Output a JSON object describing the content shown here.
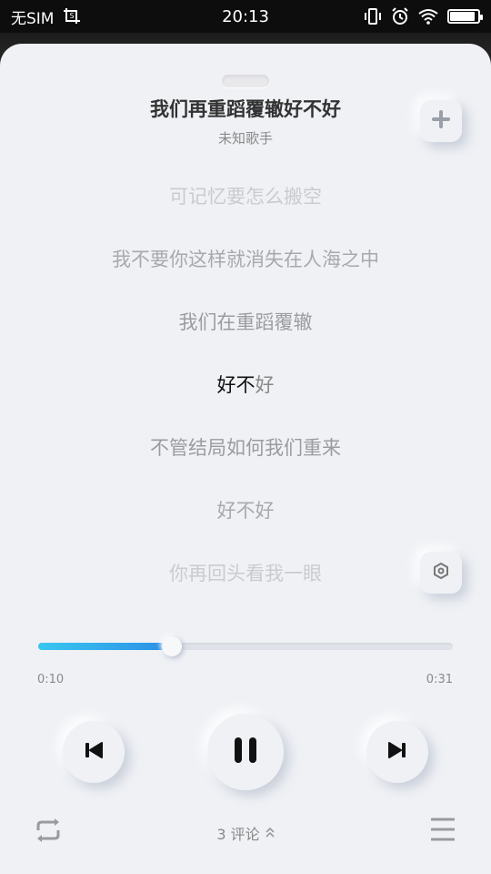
{
  "status_bar": {
    "carrier": "无SIM",
    "time": "20:13",
    "battery_level": 0.9
  },
  "song": {
    "title": "我们再重蹈覆辙好不好",
    "artist": "未知歌手"
  },
  "lyrics": {
    "lines": [
      "可记忆要怎么搬空",
      "我不要你这样就消失在人海之中",
      "我们在重蹈覆辙",
      "好不好",
      "不管结局如何我们重来",
      "好不好",
      "你再回头看我一眼"
    ],
    "current_index": 3,
    "current_sung": "好不",
    "current_rest": "好"
  },
  "progress": {
    "current": "0:10",
    "total": "0:31",
    "fraction": 0.322
  },
  "footer": {
    "comments_label": "3 评论",
    "comments_arrow": "⌃"
  },
  "icons": {
    "add": "plus-icon",
    "hex": "hexagon-icon",
    "prev": "skip-previous-icon",
    "play": "pause-icon",
    "next": "skip-next-icon",
    "repeat": "repeat-icon",
    "menu": "menu-icon"
  },
  "colors": {
    "progress_start": "#3bc6f0",
    "progress_end": "#2a8fe6",
    "sheet_bg": "#eff1f5"
  }
}
